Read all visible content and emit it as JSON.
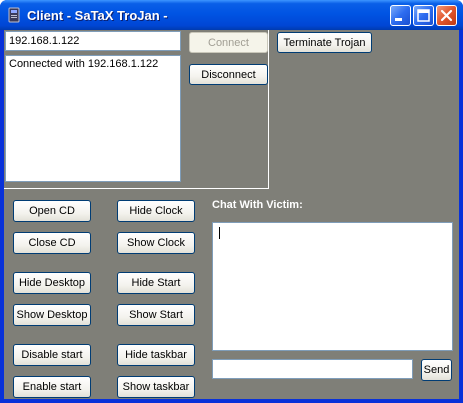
{
  "window": {
    "title": "Client - SaTaX TroJan -"
  },
  "connection": {
    "ip_value": "192.168.1.122",
    "log_text": "Connected with 192.168.1.122",
    "connect_label": "Connect",
    "disconnect_label": "Disconnect",
    "terminate_label": "Terminate Trojan"
  },
  "controls": {
    "open_cd": "Open CD",
    "close_cd": "Close CD",
    "hide_desktop": "Hide Desktop",
    "show_desktop": "Show Desktop",
    "disable_start": "Disable start",
    "enable_start": "Enable start",
    "hide_clock": "Hide Clock",
    "show_clock": "Show Clock",
    "hide_start": "Hide Start",
    "show_start": "Show Start",
    "hide_taskbar": "Hide taskbar",
    "show_taskbar": "Show taskbar"
  },
  "chat": {
    "label": "Chat With Victim:",
    "send_label": "Send",
    "message_value": ""
  },
  "colors": {
    "titlebar": "#0054e3",
    "client_bg": "#7f7f78",
    "close_button": "#e1562c"
  }
}
